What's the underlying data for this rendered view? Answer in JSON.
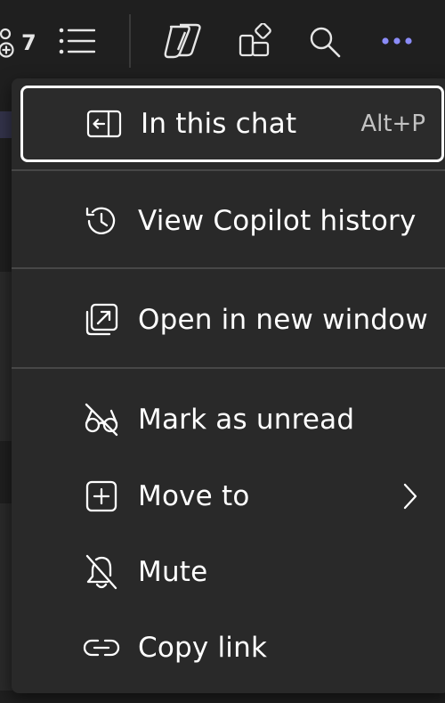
{
  "toolbar": {
    "participants_count": "7",
    "icons": [
      "people-add-icon",
      "list-icon",
      "copilot-icon",
      "apps-icon",
      "search-icon",
      "more-icon"
    ],
    "accent": "#8b8cf8"
  },
  "menu": {
    "items": [
      {
        "label": "In this chat",
        "shortcut": "Alt+P",
        "icon": "panel-left-icon"
      },
      {
        "label": "View Copilot history",
        "icon": "history-icon"
      },
      {
        "label": "Open in new window",
        "icon": "open-window-icon"
      },
      {
        "label": "Mark as unread",
        "icon": "eye-off-icon"
      },
      {
        "label": "Move to",
        "icon": "add-square-icon",
        "has_submenu": true
      },
      {
        "label": "Mute",
        "icon": "bell-off-icon"
      },
      {
        "label": "Copy link",
        "icon": "link-icon"
      }
    ]
  }
}
